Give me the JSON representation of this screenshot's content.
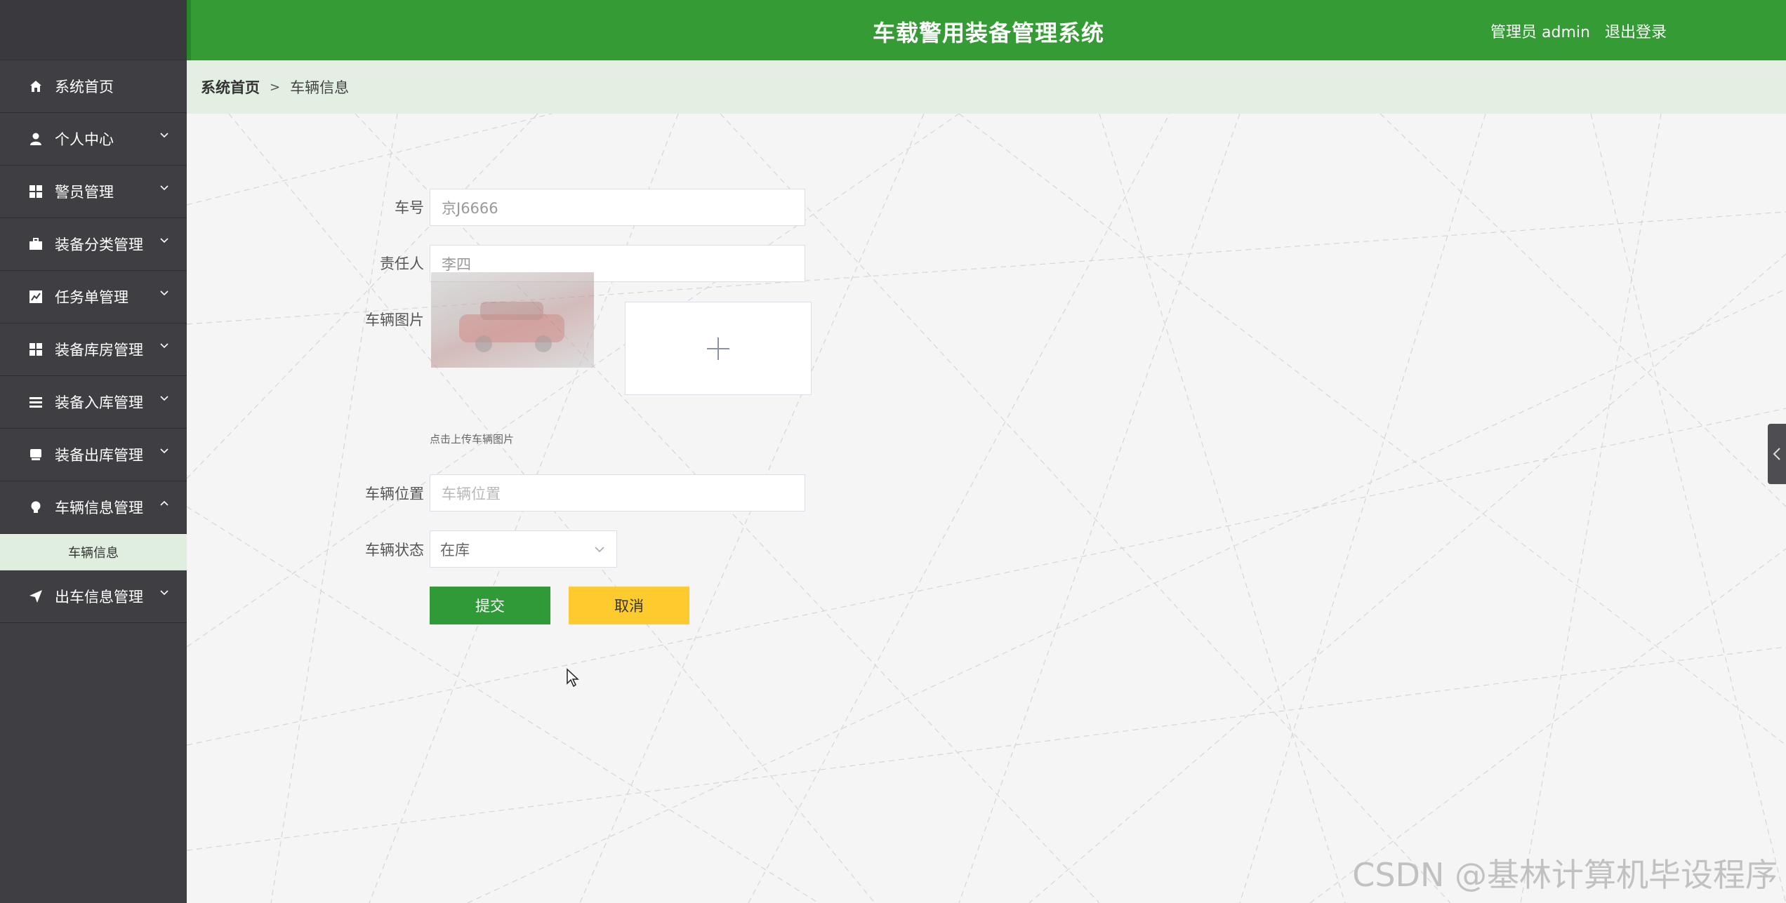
{
  "header": {
    "title": "车载警用装备管理系统",
    "user_label": "管理员 admin",
    "logout_label": "退出登录",
    "color": "#349b35"
  },
  "sidebar": {
    "items": [
      {
        "label": "系统首页",
        "icon": "home-icon",
        "has_chevron": false
      },
      {
        "label": "个人中心",
        "icon": "user-icon",
        "has_chevron": true
      },
      {
        "label": "警员管理",
        "icon": "grid-icon",
        "has_chevron": true
      },
      {
        "label": "装备分类管理",
        "icon": "briefcase-icon",
        "has_chevron": true
      },
      {
        "label": "任务单管理",
        "icon": "chart-icon",
        "has_chevron": true
      },
      {
        "label": "装备库房管理",
        "icon": "grid-icon",
        "has_chevron": true
      },
      {
        "label": "装备入库管理",
        "icon": "list-icon",
        "has_chevron": true
      },
      {
        "label": "装备出库管理",
        "icon": "inbox-icon",
        "has_chevron": true
      },
      {
        "label": "车辆信息管理",
        "icon": "bulb-icon",
        "has_chevron": true,
        "expanded": true
      },
      {
        "label": "出车信息管理",
        "icon": "send-icon",
        "has_chevron": true
      }
    ],
    "sub_item": "车辆信息"
  },
  "breadcrumb": {
    "home": "系统首页",
    "separator": ">",
    "current": "车辆信息"
  },
  "form": {
    "car_number": {
      "label": "车号",
      "value": "京J6666"
    },
    "responsible": {
      "label": "责任人",
      "value": "李四"
    },
    "image": {
      "label": "车辆图片",
      "tip": "点击上传车辆图片"
    },
    "location": {
      "label": "车辆位置",
      "placeholder": "车辆位置"
    },
    "status": {
      "label": "车辆状态",
      "value": "在库"
    },
    "submit_label": "提交",
    "cancel_label": "取消"
  },
  "watermark": "CSDN @基林计算机毕设程序"
}
